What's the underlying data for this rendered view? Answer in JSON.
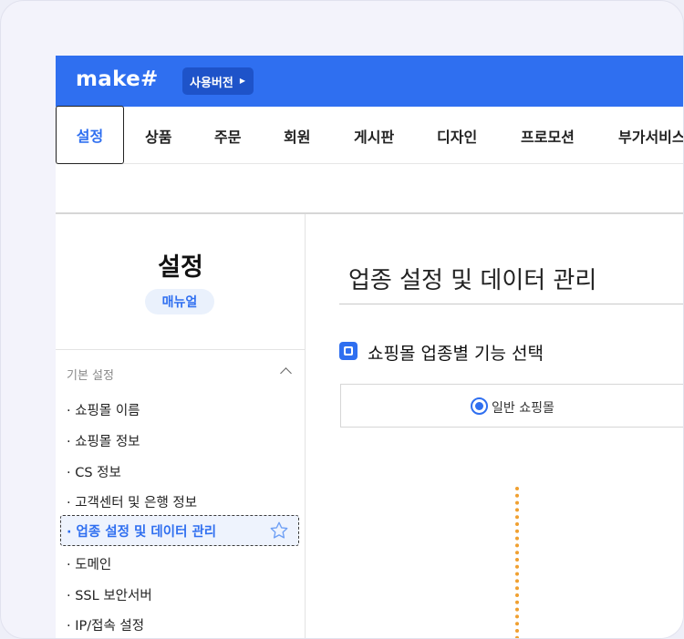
{
  "header": {
    "logo": "make#",
    "version_badge": "사용버전",
    "version_arrow_icon": "caret-right-icon"
  },
  "menu": {
    "items": [
      {
        "label": "설정",
        "active": true
      },
      {
        "label": "상품"
      },
      {
        "label": "주문"
      },
      {
        "label": "회원"
      },
      {
        "label": "게시판"
      },
      {
        "label": "디자인"
      },
      {
        "label": "프로모션"
      },
      {
        "label": "부가서비스"
      }
    ]
  },
  "sidebar": {
    "title": "설정",
    "manual_button": "매뉴얼",
    "section_header": "기본 설정",
    "items": [
      {
        "label": "· 쇼핑몰 이름"
      },
      {
        "label": "· 쇼핑몰 정보"
      },
      {
        "label": "· CS 정보"
      },
      {
        "label": "· 고객센터 및 은행 정보"
      },
      {
        "label": "· 업종 설정 및 데이터 관리",
        "active": true
      },
      {
        "label": "· 도메인"
      },
      {
        "label": "· SSL 보안서버"
      },
      {
        "label": "· IP/접속 설정"
      }
    ]
  },
  "main": {
    "title": "업종 설정 및 데이터 관리",
    "section_title": "쇼핑몰 업종별 기능 선택",
    "option_label": "일반 쇼핑몰",
    "option_selected": true
  },
  "colors": {
    "brand": "#2f6ff0",
    "active_bg": "#eef3fd",
    "dotted_guide": "#f0a030"
  }
}
